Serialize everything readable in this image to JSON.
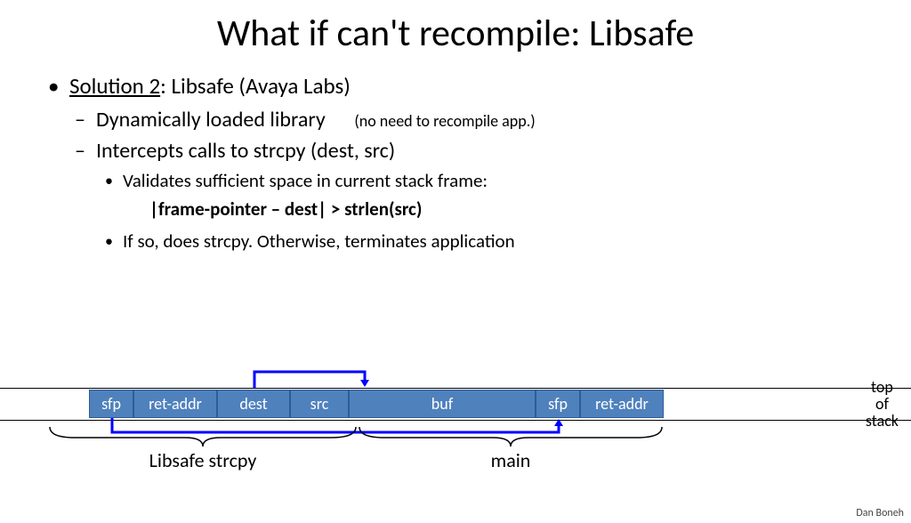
{
  "title": "What if can't recompile:  Libsafe",
  "bullets": {
    "sol2_label": "Solution 2",
    "sol2_text": ":  Libsafe (Avaya Labs)",
    "dyn": "Dynamically loaded library",
    "dyn_note": "(no need to recompile app.)",
    "intercept": "Intercepts calls to  strcpy (dest, src)",
    "validates": "Validates sufficient space in current stack frame:",
    "formula": "|frame-pointer – dest| > strlen(src)",
    "ifso": "If so, does strcpy.   Otherwise, terminates application"
  },
  "stack": {
    "c0": "sfp",
    "c1": "ret-addr",
    "c2": "dest",
    "c3": "src",
    "c4": "buf",
    "c5": "sfp",
    "c6": "ret-addr"
  },
  "labels": {
    "top_of_stack_1": "top",
    "top_of_stack_2": "of",
    "top_of_stack_3": "stack",
    "brace1": "Libsafe strcpy",
    "brace2": "main"
  },
  "footer": "Dan Boneh"
}
